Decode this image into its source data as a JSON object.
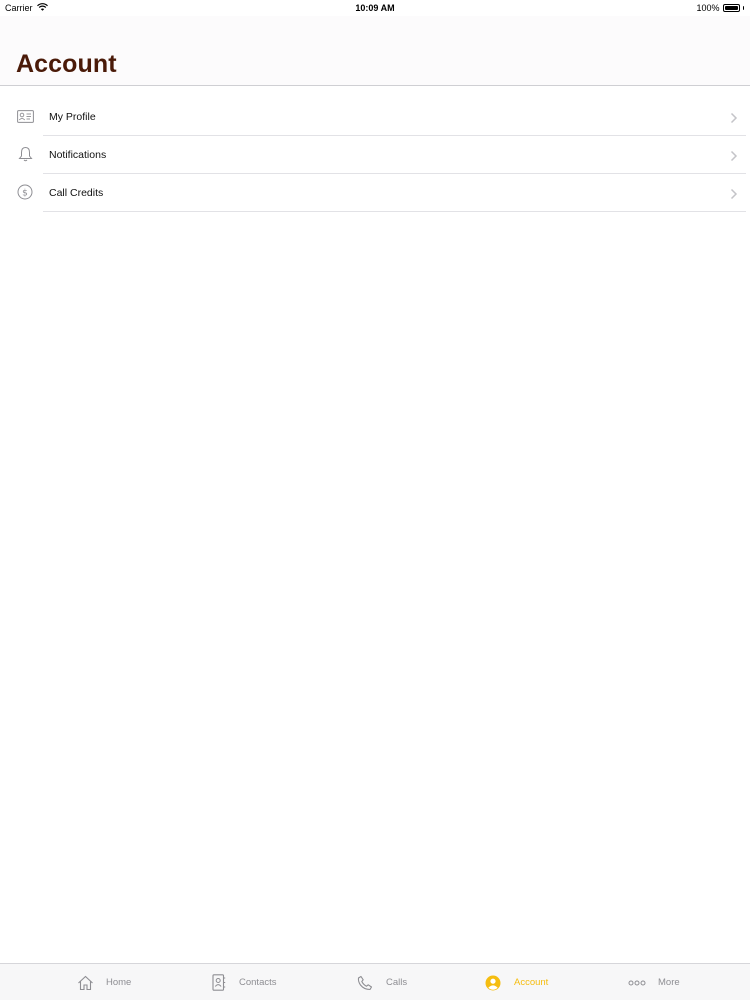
{
  "status_bar": {
    "carrier": "Carrier",
    "time": "10:09 AM",
    "battery": "100%",
    "battery_level": 1.0
  },
  "header": {
    "title": "Account"
  },
  "menu": {
    "items": [
      {
        "label": "My Profile",
        "icon": "id-card-icon"
      },
      {
        "label": "Notifications",
        "icon": "bell-icon"
      },
      {
        "label": "Call Credits",
        "icon": "dollar-circle-icon"
      }
    ]
  },
  "tab_bar": {
    "tabs": [
      {
        "label": "Home",
        "icon": "home-icon",
        "active": false
      },
      {
        "label": "Contacts",
        "icon": "contacts-book-icon",
        "active": false
      },
      {
        "label": "Calls",
        "icon": "phone-icon",
        "active": false
      },
      {
        "label": "Account",
        "icon": "person-circle-icon",
        "active": true
      },
      {
        "label": "More",
        "icon": "ellipsis-icon",
        "active": false
      }
    ],
    "active_color": "#f5bd10",
    "inactive_color": "#8e8e93"
  },
  "colors": {
    "title": "#4a1a08",
    "separator": "#e2e2e6"
  }
}
